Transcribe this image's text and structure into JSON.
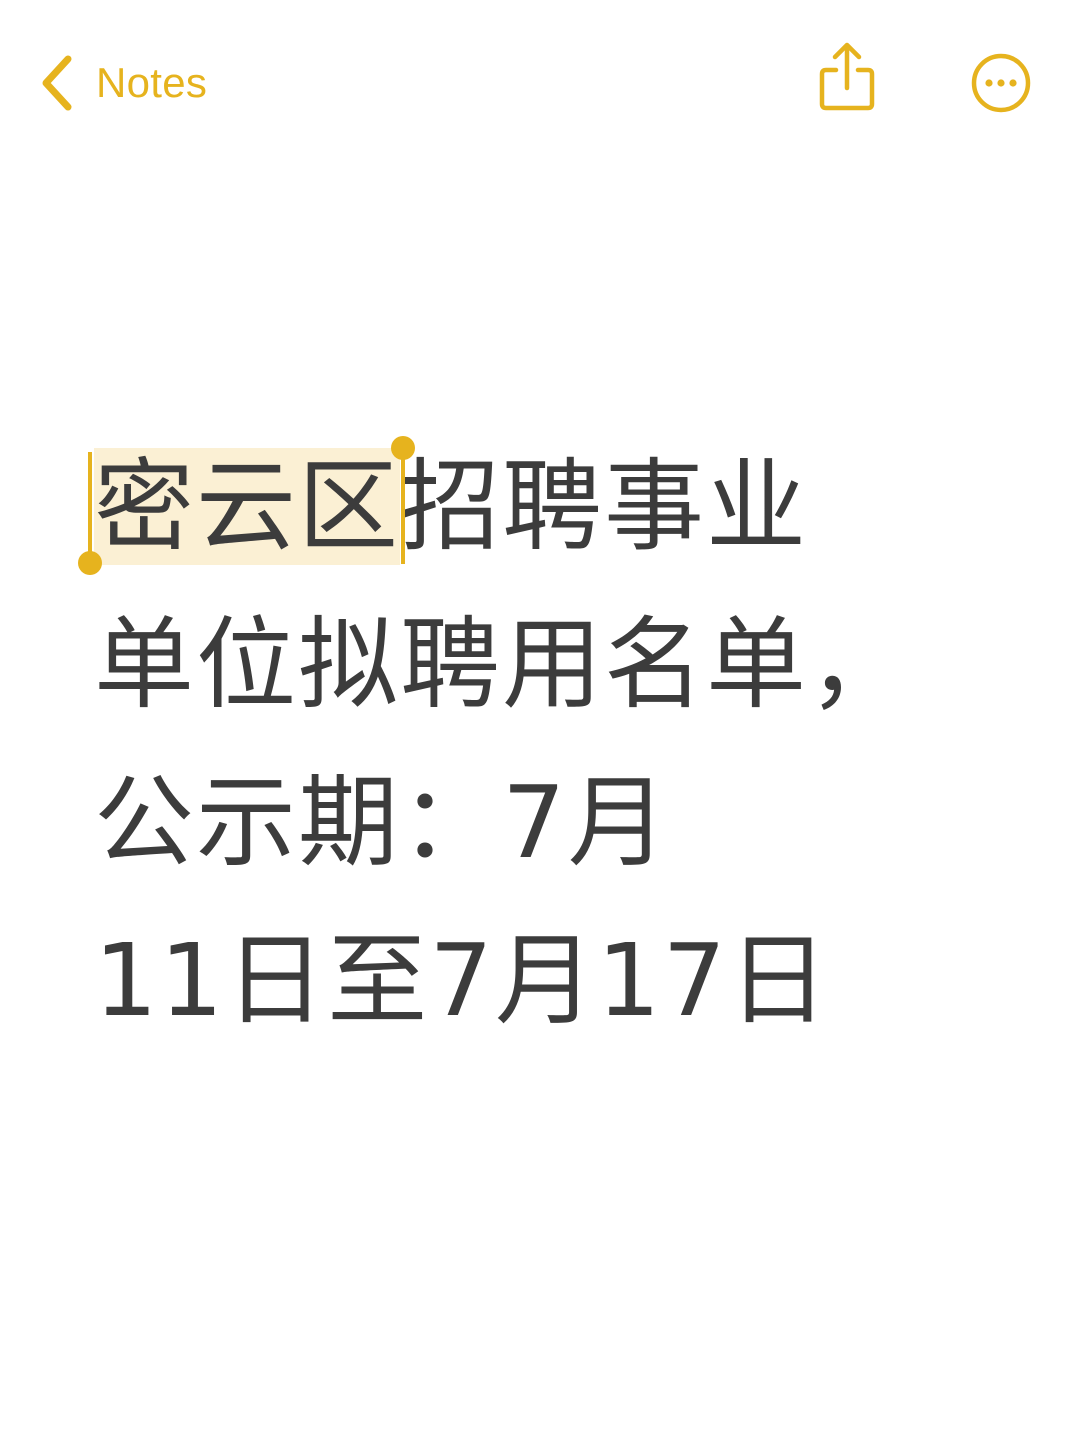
{
  "app": {
    "accent_color": "#e6b31e",
    "text_color": "#3c3c3c",
    "selection_color": "#fbf0d4"
  },
  "nav": {
    "back_label": "Notes",
    "back_icon": "chevron-left-icon",
    "share_icon": "share-icon",
    "more_icon": "ellipsis-circle-icon"
  },
  "note": {
    "selected_text": "密云区",
    "line1_rest": "招聘事业",
    "line2": "单位拟聘用名单，",
    "line3": "公示期：7月",
    "line4": "11日至7月17日"
  }
}
